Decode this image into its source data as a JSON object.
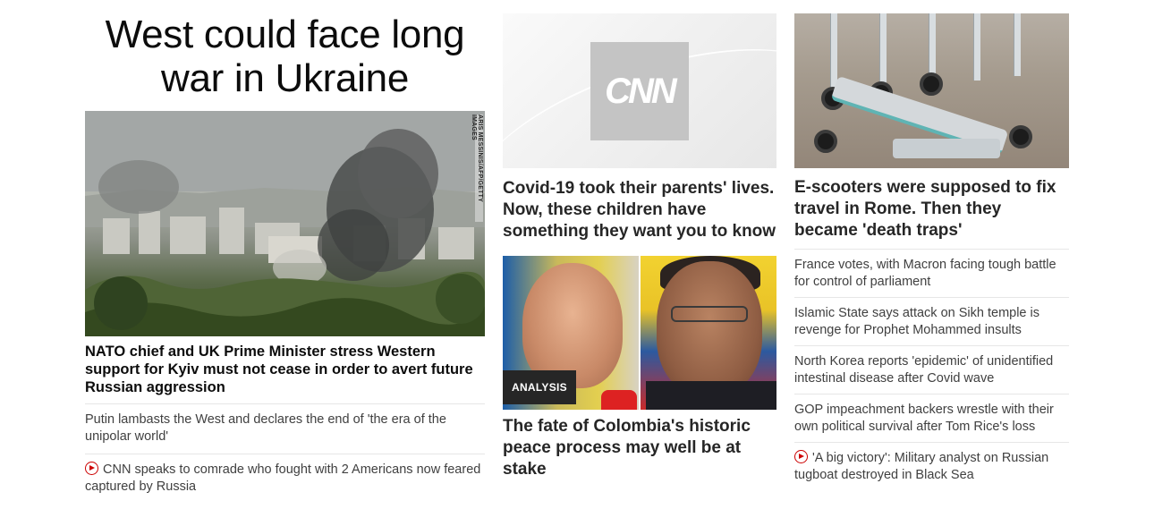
{
  "top_story": {
    "headline": "West could face long war in Ukraine",
    "photo_credit": "ARIS MESSINIS/AFP/GETTY IMAGES",
    "link": "NATO chief and UK Prime Minister stress Western support for Kyiv must not cease in order to avert future Russian aggression",
    "sub_links": [
      "Putin lambasts the West and declares the end of 'the era of the unipolar world'",
      "CNN speaks to comrade who fought with 2 Americans now feared captured by Russia"
    ]
  },
  "middle": {
    "logo_text": "CNN",
    "story1": "Covid-19 took their parents' lives. Now, these children have something they want you to know",
    "badge": "ANALYSIS",
    "story2": "The fate of Colombia's historic peace process may well be at stake"
  },
  "right": {
    "story": "E-scooters were supposed to fix travel in Rome. Then they became 'death traps'",
    "links": [
      "France votes, with Macron facing tough battle for control of parliament",
      "Islamic State says attack on Sikh temple is revenge for Prophet Mohammed insults",
      "North Korea reports 'epidemic' of unidentified intestinal disease after Covid wave",
      "GOP impeachment backers wrestle with their own political survival after Tom Rice's loss",
      "'A big victory': Military analyst on Russian tugboat destroyed in Black Sea"
    ]
  },
  "icons": {
    "video": "play-circle-icon"
  },
  "colors": {
    "accent_red": "#cc0000",
    "headline": "#0c0c0c",
    "secondary_text": "#404040",
    "badge_bg": "#262626"
  }
}
